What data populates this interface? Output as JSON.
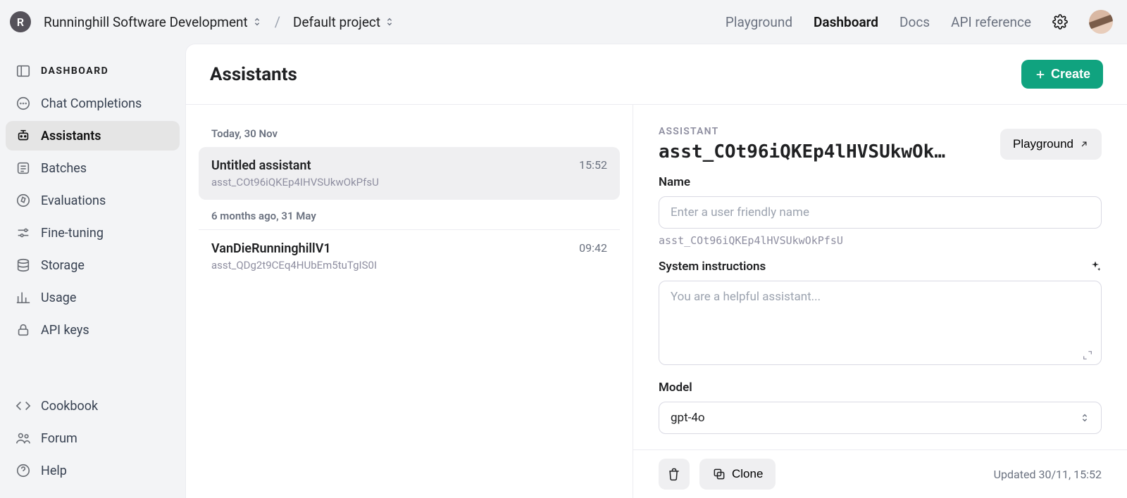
{
  "breadcrumb": {
    "org_initial": "R",
    "org": "Runninghill Software Development",
    "project": "Default project"
  },
  "topnav": {
    "playground": "Playground",
    "dashboard": "Dashboard",
    "docs": "Docs",
    "api_ref": "API reference"
  },
  "sidebar": {
    "header": "DASHBOARD",
    "items": {
      "chat": "Chat Completions",
      "assistants": "Assistants",
      "batches": "Batches",
      "evaluations": "Evaluations",
      "finetuning": "Fine-tuning",
      "storage": "Storage",
      "usage": "Usage",
      "apikeys": "API keys",
      "cookbook": "Cookbook",
      "forum": "Forum",
      "help": "Help"
    }
  },
  "page": {
    "title": "Assistants",
    "create_label": "Create"
  },
  "list": {
    "groups": [
      {
        "label": "Today, 30 Nov",
        "items": [
          {
            "name": "Untitled assistant",
            "id": "asst_COt96iQKEp4IHVSUkwOkPfsU",
            "time": "15:52",
            "selected": true
          }
        ]
      },
      {
        "label": "6 months ago, 31 May",
        "items": [
          {
            "name": "VanDieRunninghillV1",
            "id": "asst_QDg2t9CEq4HUbEm5tuTgIS0I",
            "time": "09:42",
            "selected": false
          }
        ]
      }
    ]
  },
  "detail": {
    "eyebrow": "ASSISTANT",
    "id_display": "asst_COt96iQKEp4lHVSUkwOk…",
    "playground_btn": "Playground",
    "name_label": "Name",
    "name_placeholder": "Enter a user friendly name",
    "name_hint": "asst_COt96iQKEp4lHVSUkwOkPfsU",
    "si_label": "System instructions",
    "si_placeholder": "You are a helpful assistant...",
    "model_label": "Model",
    "model_value": "gpt-4o",
    "clone_label": "Clone",
    "updated": "Updated 30/11, 15:52"
  }
}
